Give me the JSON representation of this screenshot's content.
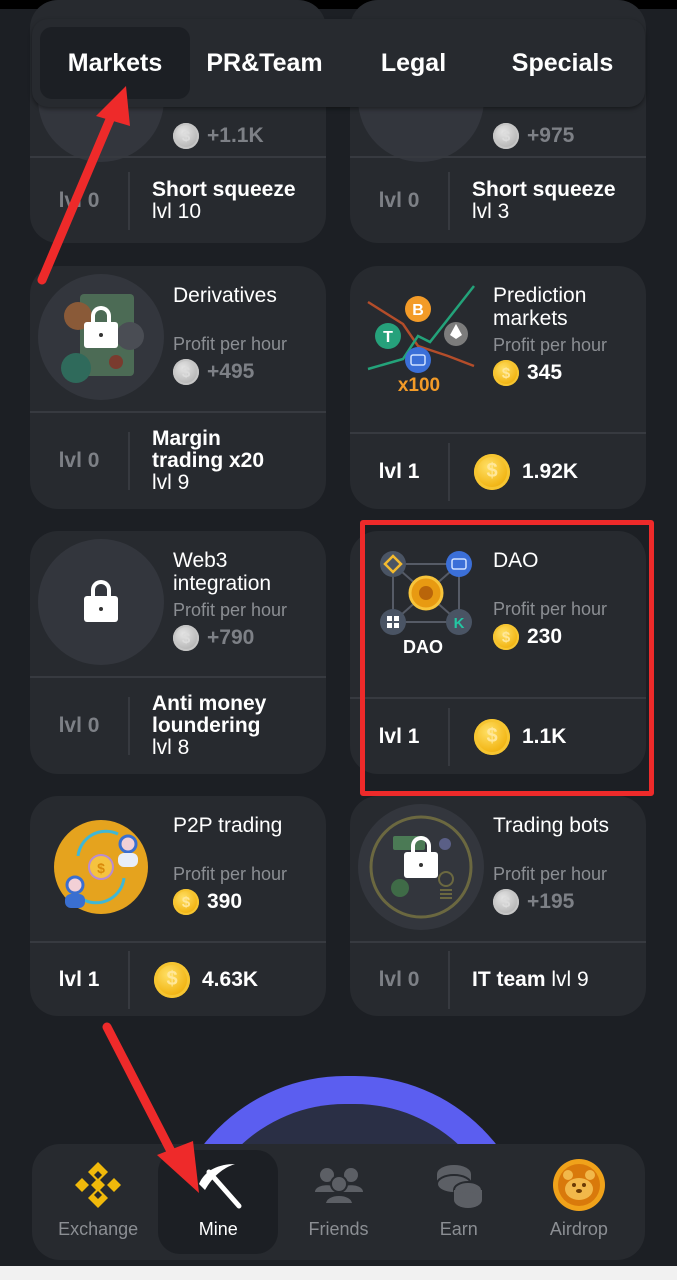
{
  "tabs": [
    {
      "label": "Markets",
      "active": true
    },
    {
      "label": "PR&Team",
      "active": false
    },
    {
      "label": "Legal",
      "active": false
    },
    {
      "label": "Specials",
      "active": false
    }
  ],
  "common": {
    "profit_label": "Profit per hour"
  },
  "cards": [
    {
      "title": "",
      "profit": "+1.1K",
      "profit_coin": "silver",
      "level": "lvl 0",
      "locked": true,
      "requirement_bold": "Short squeeze",
      "requirement_level": "lvl 10"
    },
    {
      "title": "",
      "profit": "+975",
      "profit_coin": "silver",
      "level": "lvl 0",
      "locked": true,
      "requirement_bold": "Short squeeze",
      "requirement_level": "lvl 3"
    },
    {
      "title": "Derivatives",
      "profit": "+495",
      "profit_coin": "silver",
      "level": "lvl 0",
      "locked": true,
      "requirement_bold": "Margin trading x20",
      "requirement_level": "lvl 9"
    },
    {
      "title": "Prediction markets",
      "profit": "345",
      "profit_coin": "gold",
      "level": "lvl 1",
      "locked": false,
      "cost": "1.92K",
      "image_caption": "x100"
    },
    {
      "title": "Web3 integration",
      "profit": "+790",
      "profit_coin": "silver",
      "level": "lvl 0",
      "locked": true,
      "requirement_bold": "Anti money loundering",
      "requirement_level": "lvl 8"
    },
    {
      "title": "DAO",
      "profit": "230",
      "profit_coin": "gold",
      "level": "lvl 1",
      "locked": false,
      "cost": "1.1K",
      "image_caption": "DAO"
    },
    {
      "title": "P2P trading",
      "profit": "390",
      "profit_coin": "gold",
      "level": "lvl 1",
      "locked": false,
      "cost": "4.63K"
    },
    {
      "title": "Trading bots",
      "profit": "+195",
      "profit_coin": "silver",
      "level": "lvl 0",
      "locked": true,
      "requirement_bold": "IT team",
      "requirement_level": "lvl 9"
    }
  ],
  "nav": [
    {
      "label": "Exchange",
      "icon": "binance-icon",
      "active": false
    },
    {
      "label": "Mine",
      "icon": "pickaxe-icon",
      "active": true
    },
    {
      "label": "Friends",
      "icon": "friends-icon",
      "active": false
    },
    {
      "label": "Earn",
      "icon": "coins-icon",
      "active": false
    },
    {
      "label": "Airdrop",
      "icon": "hamster-coin-icon",
      "active": false
    }
  ],
  "colors": {
    "background": "#1c1f24",
    "card": "#272a2f",
    "gold": "#f3b81a",
    "accent_arc": "#5b5ef0",
    "annotation": "#ee2a2a"
  }
}
